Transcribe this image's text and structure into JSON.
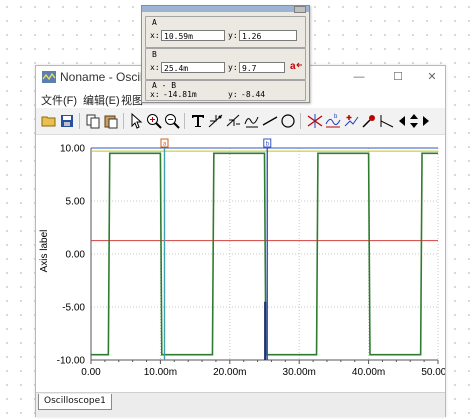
{
  "window": {
    "title": "Noname - Oscillosco",
    "controls": {
      "minimize": "—",
      "maximize": "☐",
      "close": "✕"
    }
  },
  "menu": {
    "items": [
      {
        "label": "文件(F)"
      },
      {
        "label": "编辑(E)"
      },
      {
        "label": "视图"
      }
    ]
  },
  "toolbar": {
    "icons": [
      "open-icon",
      "save-icon",
      "copy-icon",
      "paste-icon",
      "pointer-icon",
      "zoom-in-icon",
      "zoom-out-icon",
      "text-icon",
      "measure-icon",
      "slope-icon",
      "waveform-icon",
      "line-icon",
      "circle-icon",
      "cursor-a-icon",
      "cursor-b-icon",
      "marker-icon",
      "probe-icon",
      "step-icon",
      "scroll-left-icon",
      "scroll-updown-icon",
      "scroll-right-icon"
    ]
  },
  "cursor_panel": {
    "a": {
      "label": "A",
      "x_label": "x:",
      "x_value": "10.59m",
      "y_label": "y:",
      "y_value": "1.26"
    },
    "b": {
      "label": "B",
      "x_label": "x:",
      "x_value": "25.4m",
      "y_label": "y:",
      "y_value": "9.7"
    },
    "diff": {
      "label": "A - B",
      "x_label": "x:",
      "x_value": "-14.81m",
      "y_label": "y:",
      "y_value": "-8.44"
    },
    "marker_button": "a"
  },
  "tabs": [
    {
      "label": "Oscilloscope1"
    }
  ],
  "colors": {
    "square_wave": "#2e7d2e",
    "reference_top": "#c8c800",
    "reference_mid": "#d24040",
    "reference_bottom": "#3a56c8",
    "cursor_a": "#d06020",
    "cursor_b": "#3a56c8",
    "cursor_teal": "#40a0b0"
  },
  "chart_data": {
    "type": "line",
    "ylabel": "Axis label",
    "xlim": [
      0,
      50
    ],
    "ylim": [
      -10,
      10
    ],
    "x_ticks": [
      "0.00",
      "10.00m",
      "20.00m",
      "30.00m",
      "40.00m",
      "50.00m"
    ],
    "y_ticks": [
      "10.00",
      "5.00",
      "0.00",
      "-5.00",
      "-10.00"
    ],
    "grid": "dotted",
    "series": [
      {
        "kind": "square",
        "x": [
          0,
          2.5,
          2.7,
          10.0,
          10.2,
          17.5,
          17.7,
          25.0,
          25.2,
          32.5,
          32.7,
          40.0,
          40.2,
          47.5,
          47.7,
          50.0
        ],
        "y": [
          -9.5,
          -9.5,
          9.5,
          9.5,
          -9.5,
          -9.5,
          9.5,
          9.5,
          -9.5,
          -9.5,
          9.5,
          9.5,
          -9.5,
          -9.5,
          9.5,
          9.5
        ]
      }
    ],
    "reference_lines": [
      {
        "y": 9.7,
        "color": "#c8c800"
      },
      {
        "y": 1.26,
        "color": "#d24040"
      },
      {
        "y": 10.0,
        "color": "#3a56c8"
      }
    ],
    "cursors": [
      {
        "label": "a",
        "x": 10.59,
        "y": 1.26,
        "color": "#d06020"
      },
      {
        "label": "b",
        "x": 25.4,
        "y": 9.7,
        "color": "#3a56c8"
      }
    ]
  }
}
